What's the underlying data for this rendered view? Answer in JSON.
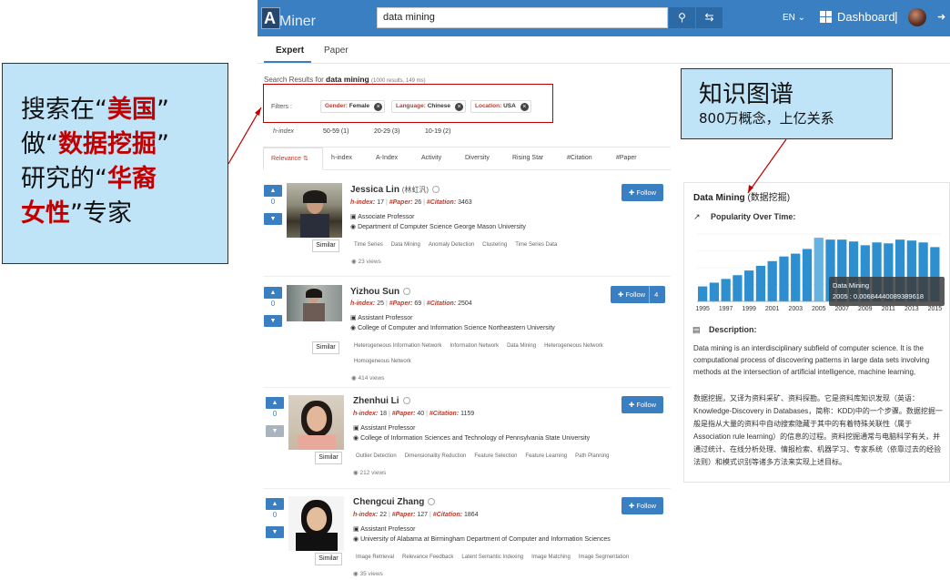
{
  "header": {
    "logo_letter": "A",
    "logo_text": "Miner",
    "search_value": "data mining",
    "lang": "EN ⌄",
    "dashboard": "Dashboard",
    "separator": "|",
    "search_icon": "search-icon",
    "refresh_icon": "refresh-icon",
    "logout_icon": "logout-icon"
  },
  "tabs": {
    "expert": "Expert",
    "paper": "Paper"
  },
  "results": {
    "prefix": "Search Results for",
    "query": "data mining",
    "count": "(1000 results, 149 ms)"
  },
  "filters": {
    "label": "Filters :",
    "chips": [
      {
        "k": "Gender:",
        "v": "Female"
      },
      {
        "k": "Language:",
        "v": "Chinese"
      },
      {
        "k": "Location:",
        "v": "USA"
      }
    ]
  },
  "hindex": {
    "label": "h-index",
    "options": [
      "50-59 (1)",
      "20-29 (3)",
      "10-19 (2)"
    ]
  },
  "sort": {
    "items": [
      "Relevance ⇅",
      "h-index",
      "A-Index",
      "Activity",
      "Diversity",
      "Rising Star",
      "#Citation",
      "#Paper"
    ]
  },
  "experts": [
    {
      "vote": "0",
      "name": "Jessica Lin",
      "cn": "(林虹汎)",
      "h": "17",
      "paper": "26",
      "citation": "3463",
      "pos": "Associate Professor",
      "aff": "Department of Computer Science George Mason University",
      "tags": [
        "Time Series",
        "Data Mining",
        "Anomaly Detection",
        "Clustering",
        "Time Series Data"
      ],
      "tags2": [],
      "views": "23 views",
      "follow": "Follow",
      "count": ""
    },
    {
      "vote": "0",
      "name": "Yizhou Sun",
      "cn": "",
      "h": "25",
      "paper": "69",
      "citation": "2504",
      "pos": "Assistant Professor",
      "aff": "College of Computer and Information Science Northeastern University",
      "tags": [
        "Heterogeneous Information Network",
        "Information Network",
        "Data Mining",
        "Heterogeneous Network"
      ],
      "tags2": [
        "Homogeneous Network"
      ],
      "views": "414 views",
      "follow": "Follow",
      "count": "4"
    },
    {
      "vote": "0",
      "name": "Zhenhui Li",
      "cn": "",
      "h": "18",
      "paper": "40",
      "citation": "1159",
      "pos": "Assistant Professor",
      "aff": "College of Information Sciences and Technology of Pennsylvania State University",
      "tags": [
        "Outlier Detection",
        "Dimensionality Reduction",
        "Feature Selection",
        "Feature Learning",
        "Path Planning"
      ],
      "tags2": [],
      "views": "212 views",
      "follow": "Follow",
      "count": ""
    },
    {
      "vote": "0",
      "name": "Chengcui Zhang",
      "cn": "",
      "h": "22",
      "paper": "127",
      "citation": "1864",
      "pos": "Assistant Professor",
      "aff": "University of Alabama at Birmingham Department of Computer and Information Sciences",
      "tags": [
        "Image Retrieval",
        "Relevance Feedback",
        "Latent Semantic Indexing",
        "Image Matching",
        "Image Segmentation"
      ],
      "tags2": [],
      "views": "35 views",
      "follow": "Follow",
      "count": ""
    }
  ],
  "labels": {
    "hindex": "h-index:",
    "paper": "#Paper:",
    "citation": "#Citation:",
    "similar": "Similar"
  },
  "panel": {
    "title": "Data Mining",
    "title_cn": "(数据挖掘)",
    "popularity": "Popularity Over Time:",
    "description": "Description:",
    "desc_en": "Data mining is an interdisciplinary subfield of computer science. It is the computational process of discovering patterns in large data sets involving methods at the intersection of artificial intelligence, machine learning, statistics, and database systems.",
    "desc_cn": "数据挖掘，又译为资料采矿、资料探勘。它是资料库知识发现（英语：Knowledge-Discovery in Databases，简称：KDD)中的一个步骤。数据挖掘一般是指从大量的资料中自动搜索隐藏于其中的有着特殊关联性（属于Association rule learning）的信息的过程。资料挖掘通常与电脑科学有关，并通过统计、在线分析处理、情报检索、机器学习、专家系统（依靠过去的经验法则）和模式识别等诸多方法来实现上述目标。",
    "tooltip_name": "Data Mining",
    "tooltip_value": "2005 : 0.00684440089389618"
  },
  "chart_data": {
    "type": "bar",
    "x": [
      1995,
      1996,
      1997,
      1998,
      1999,
      2000,
      2001,
      2002,
      2003,
      2004,
      2005,
      2006,
      2007,
      2008,
      2009,
      2010,
      2011,
      2012,
      2013,
      2014,
      2015
    ],
    "values": [
      0.0016,
      0.002,
      0.0024,
      0.0028,
      0.0033,
      0.0038,
      0.0043,
      0.0048,
      0.0051,
      0.0056,
      0.0068,
      0.0066,
      0.0066,
      0.0064,
      0.006,
      0.0063,
      0.0062,
      0.0066,
      0.0065,
      0.0063,
      0.0058
    ],
    "xticks": [
      "1995",
      "1997",
      "1999",
      "2001",
      "2003",
      "2005",
      "2007",
      "2009",
      "2011",
      "2013",
      "2015"
    ],
    "highlight": 2005,
    "color": "#2e8fd0",
    "highlight_color": "#64b3e3"
  },
  "callout_left": {
    "l1a": "搜索在“",
    "l1b": "美国",
    "l1c": "”",
    "l2a": "做“",
    "l2b": "数据挖掘",
    "l2c": "”",
    "l3a": "研究的“",
    "l3b": "华裔",
    "l4a": "女性",
    "l4b": "”专家"
  },
  "callout_right": {
    "title": "知识图谱",
    "sub": "800万概念，上亿关系"
  }
}
